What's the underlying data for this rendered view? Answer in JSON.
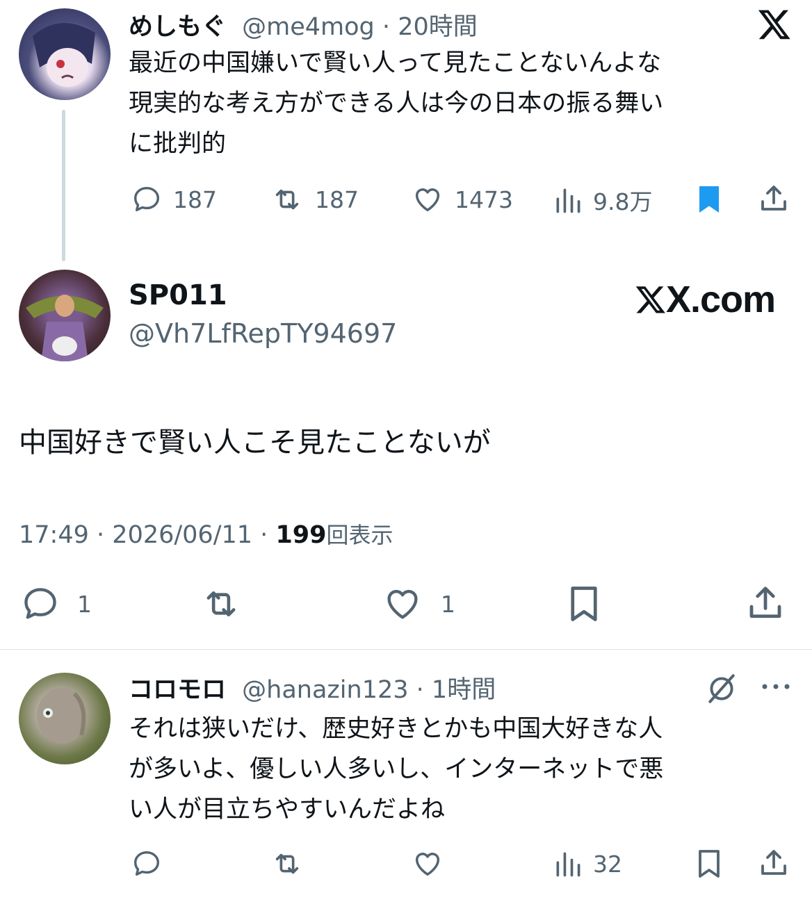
{
  "tweet1": {
    "display_name": "めしもぐ",
    "handle": "@me4mog",
    "separator": "·",
    "time": "20時間",
    "lines": [
      "最近の中国嫌いで賢い人って見たことないんよな",
      "現実的な考え方ができる人は今の日本の振る舞い",
      "に批判的"
    ],
    "stats": {
      "replies": "187",
      "reposts": "187",
      "likes": "1473",
      "views": "9.8万"
    },
    "bookmark_color": "#1d9bf0"
  },
  "tweet2": {
    "display_name": "SP011",
    "handle": "@Vh7LfRepTY94697",
    "brand": "X.com",
    "text": "中国好きで賢い人こそ見たことないが",
    "time": "17:49",
    "date": "2026/06/11",
    "separator": "·",
    "views_count": "199",
    "views_label": "回表示",
    "stats": {
      "replies": "1",
      "likes": "1"
    }
  },
  "tweet3": {
    "display_name": "コロモロ",
    "handle": "@hanazin123",
    "separator": "·",
    "time": "1時間",
    "lines": [
      "それは狭いだけ、歴史好きとかも中国大好きな人",
      "が多いよ、優しい人多いし、インターネットで悪",
      "い人が目立ちやすいんだよね"
    ],
    "stats": {
      "views": "32"
    }
  },
  "icons": [
    "x-logo-icon",
    "reply-icon",
    "repost-icon",
    "like-icon",
    "views-icon",
    "bookmark-icon",
    "share-icon",
    "grok-icon",
    "more-icon"
  ]
}
